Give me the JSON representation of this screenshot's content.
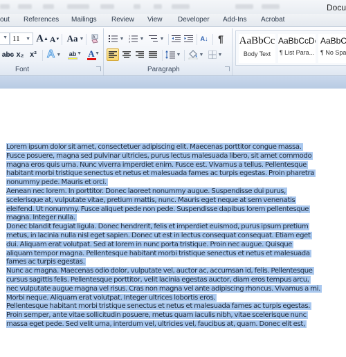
{
  "window": {
    "title_partial": "Docu"
  },
  "tabs": [
    {
      "label": "out"
    },
    {
      "label": "References"
    },
    {
      "label": "Mailings"
    },
    {
      "label": "Review"
    },
    {
      "label": "View"
    },
    {
      "label": "Developer"
    },
    {
      "label": "Add-Ins"
    },
    {
      "label": "Acrobat"
    }
  ],
  "ribbon": {
    "font_group": {
      "label": "Font",
      "font_size": "11",
      "buttons": {
        "grow_font": "A",
        "shrink_font": "A",
        "change_case": "Aa",
        "strikethrough": "abc",
        "subscript": "x₂",
        "superscript": "x²",
        "text_effects": "A",
        "highlight": "ab",
        "font_color": "A"
      }
    },
    "paragraph_group": {
      "label": "Paragraph",
      "active_alignment": "align-left",
      "show_marks": "¶",
      "sort": "A↓"
    },
    "styles": [
      {
        "sample": "AaBbCc",
        "name": "Body Text"
      },
      {
        "sample": "AaBbCcDc",
        "name": "¶ List Para..."
      },
      {
        "sample": "AaBbCc",
        "name": "¶ No Spa"
      }
    ]
  },
  "colors": {
    "selection": "#a9c8ef",
    "active_button": "#f8d66e",
    "font_color_bar": "#e01010",
    "highlight_bar": "#f5f530"
  },
  "document": {
    "paragraphs": [
      {
        "lines": [
          "Lorem ipsum dolor sit amet, consectetuer adipiscing elit. Maecenas porttitor congue massa.",
          "Fusce posuere, magna sed pulvinar ultricies, purus lectus malesuada libero, sit amet commodo",
          "magna eros quis urna. Nunc viverra imperdiet enim. Fusce est. Vivamus a tellus. Pellentesque",
          "habitant morbi tristique senectus et netus et malesuada fames ac turpis egestas. Proin pharetra",
          "nonummy pede. Mauris et orci."
        ]
      },
      {
        "lines": [
          "Aenean nec lorem. In porttitor. Donec laoreet nonummy augue. Suspendisse dui purus,",
          "scelerisque at, vulputate vitae, pretium mattis, nunc. Mauris eget neque at sem venenatis",
          "eleifend. Ut nonummy. Fusce aliquet pede non pede. Suspendisse dapibus lorem pellentesque",
          "magna. Integer nulla."
        ]
      },
      {
        "lines": [
          "Donec blandit feugiat ligula.  Donec hendrerit, felis et imperdiet euismod, purus ipsum pretium",
          "metus, in lacinia nulla nisl eget sapien. Donec ut est in  lectus consequat consequat. Etiam eget",
          "dui. Aliquam erat volutpat. Sed at  lorem in  nunc porta tristique. Proin nec augue. Quisque",
          "aliquam tempor magna. Pellentesque habitant morbi tristique senectus et netus et malesuada",
          "fames ac turpis egestas."
        ]
      },
      {
        "lines": [
          "Nunc ac magna. Maecenas odio dolor, vulputate vel, auctor ac, accumsan id, felis. Pellentesque",
          "cursus sagittis felis. Pellentesque porttitor, velit lacinia egestas auctor, diam eros tempus arcu,",
          "nec vulputate augue magna vel risus. Cras non magna vel ante adipiscing rhoncus. Vivamus a mi.",
          "Morbi neque. Aliquam erat volutpat. Integer ultrices lobortis eros."
        ]
      },
      {
        "lines": [
          "Pellentesque habitant morbi tristique senectus et netus et malesuada fames ac turpis egestas.",
          "Proin semper, ante vitae sollicitudin posuere, metus quam iaculis nibh, vitae scelerisque nunc",
          "massa eget pede. Sed velit urna, interdum vel, ultricies vel, faucibus at, quam. Donec elit est,"
        ]
      }
    ]
  }
}
